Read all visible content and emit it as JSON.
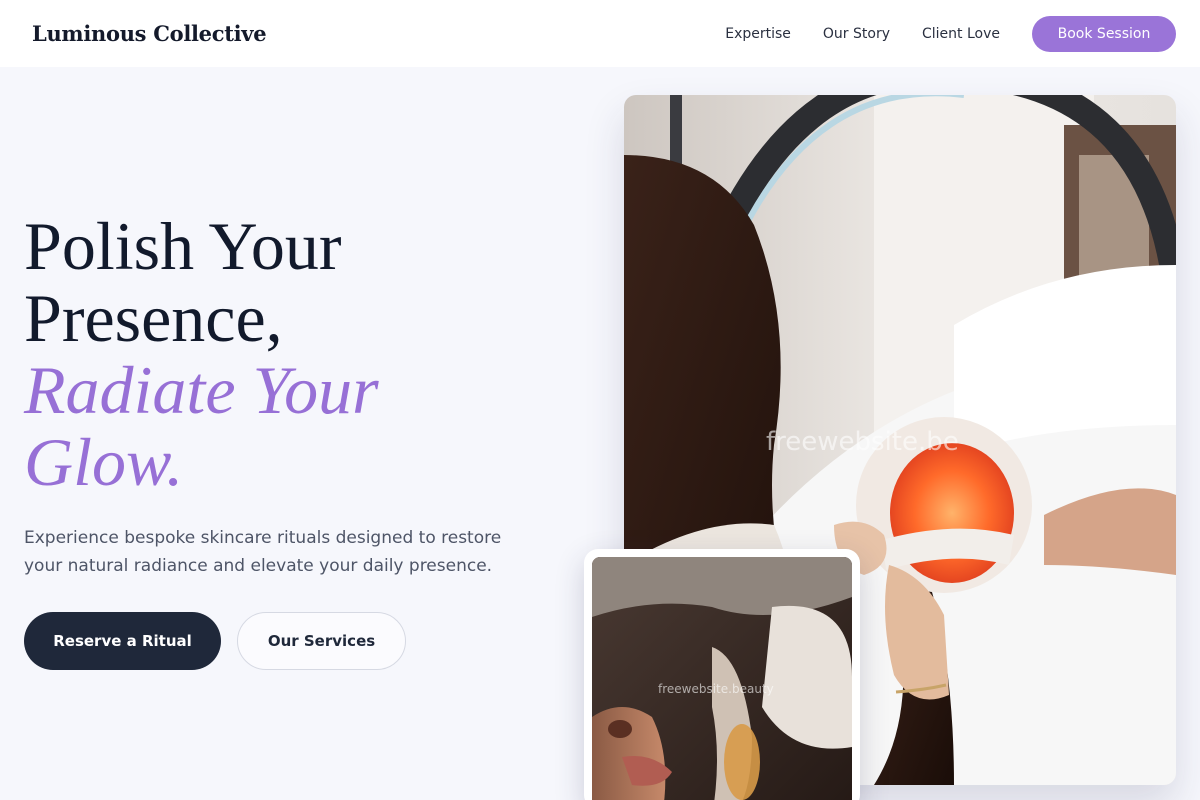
{
  "header": {
    "brand": "Luminous Collective",
    "nav": [
      {
        "label": "Expertise"
      },
      {
        "label": "Our Story"
      },
      {
        "label": "Client Love"
      }
    ],
    "cta_label": "Book Session"
  },
  "hero": {
    "headline_line1": "Polish Your",
    "headline_line2": "Presence,",
    "headline_accent1": "Radiate Your",
    "headline_accent2": "Glow.",
    "subtext": "Experience bespoke skincare rituals designed to restore your natural radiance and elevate your daily presence.",
    "primary_cta": "Reserve a Ritual",
    "secondary_cta": "Our Services"
  },
  "images": {
    "main_watermark": "freewebsite.be",
    "inset_watermark": "freewebsite.beauty"
  },
  "colors": {
    "accent": "#9770d6",
    "dark": "#1f283a",
    "background": "#f6f7fc"
  }
}
